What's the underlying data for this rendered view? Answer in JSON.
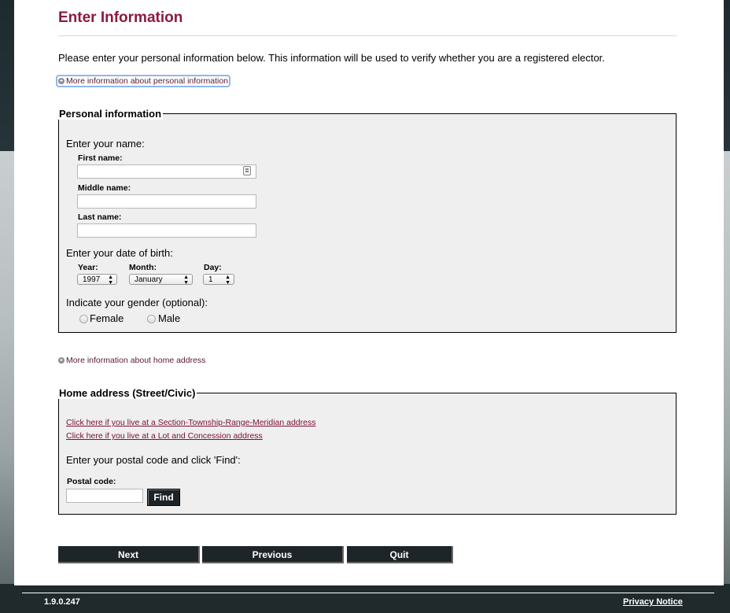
{
  "page_title": "Enter Information",
  "intro_text": "Please enter your personal information below. This information will be used to verify whether you are a registered elector.",
  "more_info_personal": "More information about personal information",
  "personal": {
    "legend": "Personal information",
    "name_prompt": "Enter your name:",
    "first_name_label": "First name:",
    "first_name_value": "",
    "middle_name_label": "Middle name:",
    "middle_name_value": "",
    "last_name_label": "Last name:",
    "last_name_value": "",
    "dob_prompt": "Enter your date of birth:",
    "year_label": "Year:",
    "year_value": "1997",
    "month_label": "Month:",
    "month_value": "January",
    "day_label": "Day:",
    "day_value": "1",
    "gender_prompt": "Indicate your gender (optional):",
    "gender_female": "Female",
    "gender_male": "Male"
  },
  "more_info_address": "More information about home address",
  "address": {
    "legend": "Home address (Street/Civic)",
    "link_strm": "Click here if you live at a Section-Township-Range-Meridian address",
    "link_lot": "Click here if you live at a Lot and Concession address",
    "postal_prompt": "Enter your postal code and click 'Find':",
    "postal_label": "Postal code:",
    "postal_value": "",
    "find_label": "Find"
  },
  "nav": {
    "next": "Next",
    "previous": "Previous",
    "quit": "Quit"
  },
  "footer": {
    "version": "1.9.0.247",
    "privacy": "Privacy Notice"
  },
  "colors": {
    "title": "#8b1a3b",
    "link": "#7a1030",
    "button_bg": "#1e2529",
    "fieldset_bg": "#efefef"
  }
}
